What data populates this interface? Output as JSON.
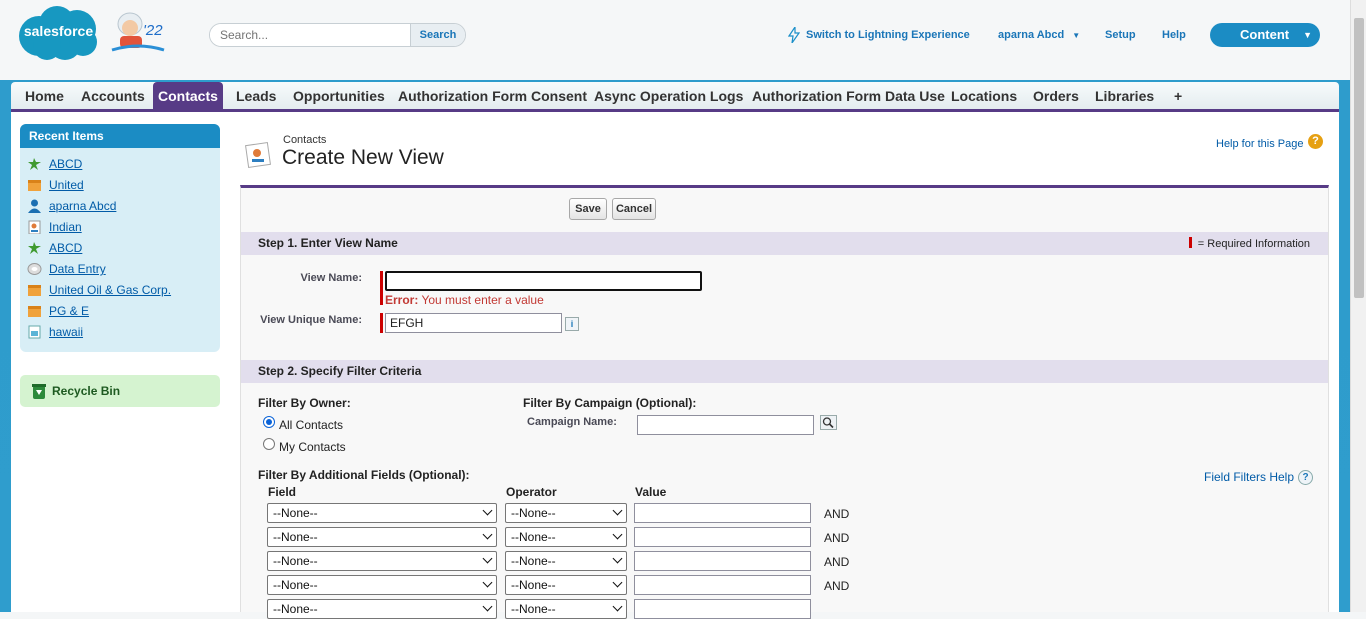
{
  "header": {
    "logo_text": "salesforce",
    "mascot_year": "'22",
    "search_placeholder": "Search...",
    "search_button": "Search",
    "lightning_link": "Switch to Lightning Experience",
    "user_menu": "aparna Abcd",
    "setup_link": "Setup",
    "help_link": "Help",
    "app_menu": "Content"
  },
  "tabs": [
    "Home",
    "Accounts",
    "Contacts",
    "Leads",
    "Opportunities",
    "Authorization Form Consent",
    "Async Operation Logs",
    "Authorization Form Data Use",
    "Locations",
    "Orders",
    "Libraries",
    "+"
  ],
  "active_tab": "Contacts",
  "sidebar": {
    "recent_title": "Recent Items",
    "recent_items": [
      {
        "label": "ABCD",
        "icon": "lead-icon"
      },
      {
        "label": "United",
        "icon": "account-icon"
      },
      {
        "label": "aparna Abcd",
        "icon": "user-icon"
      },
      {
        "label": "Indian",
        "icon": "contact-icon"
      },
      {
        "label": "ABCD",
        "icon": "lead-icon"
      },
      {
        "label": "Data Entry",
        "icon": "report-icon"
      },
      {
        "label": "United Oil & Gas Corp.",
        "icon": "account-icon"
      },
      {
        "label": "PG & E",
        "icon": "account-icon"
      },
      {
        "label": "hawaii",
        "icon": "document-icon"
      }
    ],
    "recycle_bin": "Recycle Bin"
  },
  "page": {
    "breadcrumb": "Contacts",
    "title": "Create New View",
    "help_link": "Help for this Page",
    "save_button": "Save",
    "cancel_button": "Cancel"
  },
  "step1": {
    "title": "Step 1. Enter View Name",
    "required_info": "= Required Information",
    "view_name_label": "View Name:",
    "view_name_value": "",
    "error_prefix": "Error:",
    "error_text": "You must enter a value",
    "unique_name_label": "View Unique Name:",
    "unique_name_value": "EFGH",
    "info_icon": "i"
  },
  "step2": {
    "title": "Step 2. Specify Filter Criteria",
    "owner_label": "Filter By Owner:",
    "owner_options": [
      "All Contacts",
      "My Contacts"
    ],
    "owner_selected": "All Contacts",
    "campaign_label": "Filter By Campaign (Optional):",
    "campaign_name_label": "Campaign Name:",
    "campaign_name_value": "",
    "field_filters_help": "Field Filters Help",
    "additional_label": "Filter By Additional Fields (Optional):",
    "columns": {
      "field": "Field",
      "operator": "Operator",
      "value": "Value"
    },
    "rows": [
      {
        "field": "--None--",
        "operator": "--None--",
        "value": "",
        "conj": "AND"
      },
      {
        "field": "--None--",
        "operator": "--None--",
        "value": "",
        "conj": "AND"
      },
      {
        "field": "--None--",
        "operator": "--None--",
        "value": "",
        "conj": "AND"
      },
      {
        "field": "--None--",
        "operator": "--None--",
        "value": "",
        "conj": "AND"
      },
      {
        "field": "--None--",
        "operator": "--None--",
        "value": "",
        "conj": ""
      }
    ]
  },
  "colors": {
    "accent": "#573b86",
    "brand_blue": "#1b8cc4",
    "error": "#c23934",
    "link": "#015ba7"
  }
}
